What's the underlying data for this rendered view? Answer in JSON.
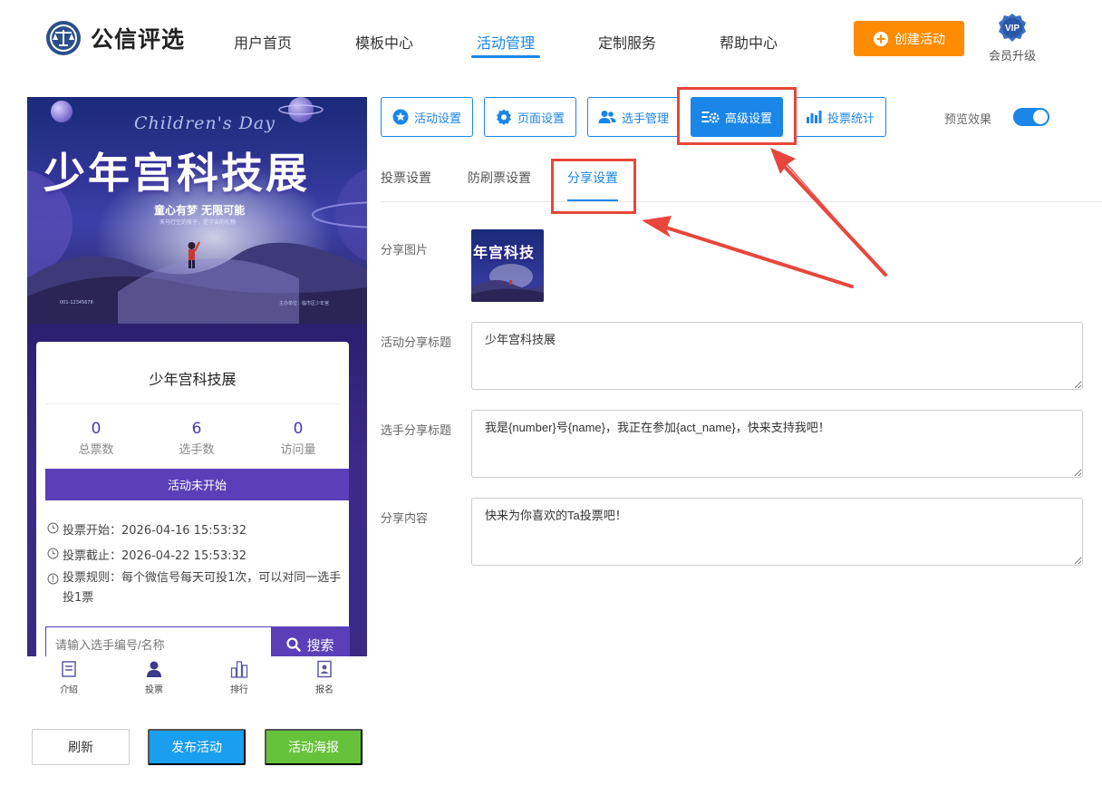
{
  "brand": {
    "name": "公信评选"
  },
  "nav": {
    "items": [
      {
        "label": "用户首页"
      },
      {
        "label": "模板中心"
      },
      {
        "label": "活动管理"
      },
      {
        "label": "定制服务"
      },
      {
        "label": "帮助中心"
      }
    ],
    "active_index": 2,
    "create_label": "创建活动",
    "vip_badge": "VIP",
    "vip_label": "会员升级"
  },
  "preview": {
    "banner": {
      "script": "Children's Day",
      "title": "少年宫科技展",
      "slogan": "童心有梦 无限可能",
      "sub": "天马行空的孩子，是宇宙的礼物",
      "foot_left": "001-12345678",
      "foot_right": "主办单位：临市区少年宫"
    },
    "card_title": "少年宫科技展",
    "stats": [
      {
        "num": "0",
        "label": "总票数"
      },
      {
        "num": "6",
        "label": "选手数"
      },
      {
        "num": "0",
        "label": "访问量"
      }
    ],
    "status": "活动未开始",
    "start": "投票开始：2026-04-16 15:53:32",
    "end": "投票截止：2026-04-22 15:53:32",
    "rule": "投票规则：每个微信号每天可投1次，可以对同一选手投1票",
    "search_placeholder": "请输入选手编号/名称",
    "search_label": "搜索",
    "tabbar": [
      {
        "label": "介绍"
      },
      {
        "label": "投票"
      },
      {
        "label": "排行"
      },
      {
        "label": "报名"
      }
    ]
  },
  "bottom_buttons": {
    "refresh": "刷新",
    "publish": "发布活动",
    "poster": "活动海报"
  },
  "toolbar": {
    "buttons": [
      {
        "label": "活动设置",
        "icon": "star-icon"
      },
      {
        "label": "页面设置",
        "icon": "gear-icon"
      },
      {
        "label": "选手管理",
        "icon": "users-icon"
      },
      {
        "label": "高级设置",
        "icon": "sliders-gear-icon"
      },
      {
        "label": "投票统计",
        "icon": "bar-chart-icon"
      }
    ],
    "active_index": 3,
    "preview_label": "预览效果",
    "preview_on": true
  },
  "subtabs": {
    "items": [
      {
        "label": "投票设置"
      },
      {
        "label": "防刷票设置"
      },
      {
        "label": "分享设置"
      }
    ],
    "active_index": 2
  },
  "form": {
    "image_label": "分享图片",
    "thumb_text": "年宫科技",
    "title_label": "活动分享标题",
    "title_value": "少年宫科技展",
    "player_label": "选手分享标题",
    "player_value": "我是{number}号{name}，我正在参加{act_name}，快来支持我吧！",
    "content_label": "分享内容",
    "content_value": "快来为你喜欢的Ta投票吧！"
  },
  "colors": {
    "primary": "#1a86e8",
    "accent": "#ff8c00",
    "purple": "#5a3fb8",
    "annotation": "#e8463c"
  }
}
